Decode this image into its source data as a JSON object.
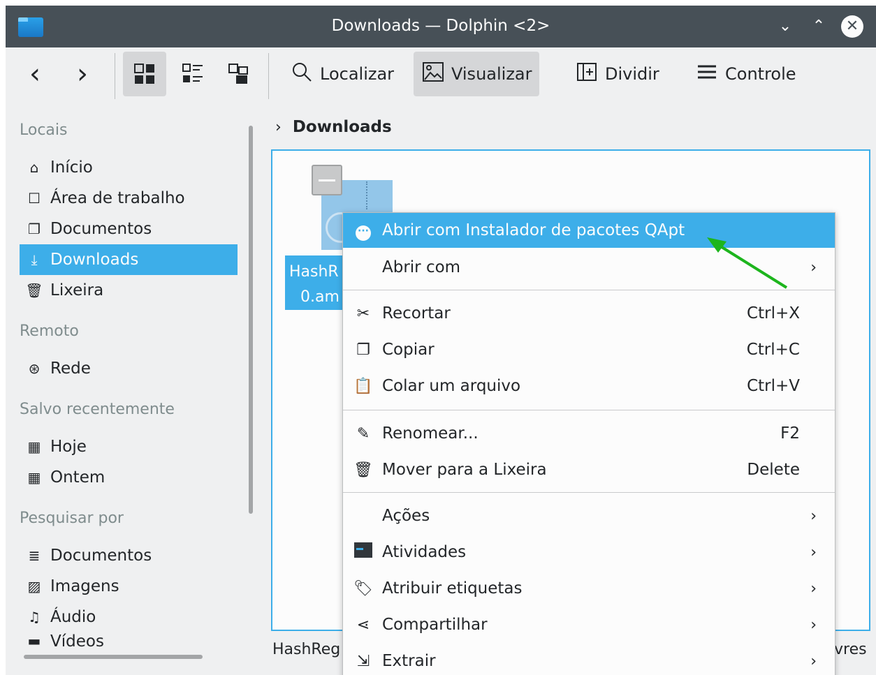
{
  "window": {
    "title": "Downloads — Dolphin <2>",
    "controls": {
      "minimize": "⌄",
      "maximize": "⌃",
      "close": "✕"
    }
  },
  "toolbar": {
    "back": "‹",
    "forward": "›",
    "find_label": "Localizar",
    "preview_label": "Visualizar",
    "split_label": "Dividir",
    "control_label": "Controle"
  },
  "sidebar": {
    "places_header": "Locais",
    "places": [
      {
        "label": "Início",
        "icon": "home-icon"
      },
      {
        "label": "Área de trabalho",
        "icon": "desktop-icon"
      },
      {
        "label": "Documentos",
        "icon": "documents-icon"
      },
      {
        "label": "Downloads",
        "icon": "downloads-icon",
        "selected": true
      },
      {
        "label": "Lixeira",
        "icon": "trash-icon"
      }
    ],
    "remote_header": "Remoto",
    "remote": [
      {
        "label": "Rede",
        "icon": "network-icon"
      }
    ],
    "recent_header": "Salvo recentemente",
    "recent": [
      {
        "label": "Hoje",
        "icon": "calendar-icon"
      },
      {
        "label": "Ontem",
        "icon": "calendar-icon"
      }
    ],
    "search_header": "Pesquisar por",
    "search": [
      {
        "label": "Documentos",
        "icon": "text-icon"
      },
      {
        "label": "Imagens",
        "icon": "image-icon"
      },
      {
        "label": "Áudio",
        "icon": "music-icon"
      },
      {
        "label": "Vídeos",
        "icon": "video-icon"
      }
    ]
  },
  "breadcrumb": {
    "current": "Downloads"
  },
  "file": {
    "name_line1": "HashR",
    "name_line2": "0.am"
  },
  "statusbar": {
    "left": "HashReg",
    "right": "vres"
  },
  "context_menu": {
    "open_with_qapt": "Abrir com Instalador de pacotes QApt",
    "open_with": "Abrir com",
    "cut": "Recortar",
    "cut_sc": "Ctrl+X",
    "copy": "Copiar",
    "copy_sc": "Ctrl+C",
    "paste": "Colar um arquivo",
    "paste_sc": "Ctrl+V",
    "rename": "Renomear...",
    "rename_sc": "F2",
    "trash": "Mover para a Lixeira",
    "trash_sc": "Delete",
    "actions": "Ações",
    "activities": "Atividades",
    "tags": "Atribuir etiquetas",
    "share": "Compartilhar",
    "extract": "Extrair"
  },
  "colors": {
    "accent": "#3daee9",
    "titlebar": "#475057",
    "annotation_arrow": "#1db51d"
  }
}
